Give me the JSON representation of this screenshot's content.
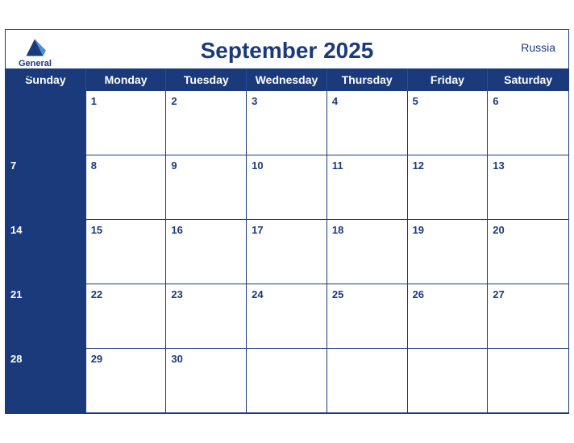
{
  "header": {
    "logo": {
      "general": "General",
      "blue": "Blue"
    },
    "title": "September 2025",
    "country": "Russia"
  },
  "days": [
    "Sunday",
    "Monday",
    "Tuesday",
    "Wednesday",
    "Thursday",
    "Friday",
    "Saturday"
  ],
  "weeks": [
    [
      {
        "date": "",
        "rowStart": true
      },
      {
        "date": "1",
        "rowStart": false
      },
      {
        "date": "2",
        "rowStart": false
      },
      {
        "date": "3",
        "rowStart": false
      },
      {
        "date": "4",
        "rowStart": false
      },
      {
        "date": "5",
        "rowStart": false
      },
      {
        "date": "6",
        "rowStart": false
      }
    ],
    [
      {
        "date": "7",
        "rowStart": true
      },
      {
        "date": "8",
        "rowStart": false
      },
      {
        "date": "9",
        "rowStart": false
      },
      {
        "date": "10",
        "rowStart": false
      },
      {
        "date": "11",
        "rowStart": false
      },
      {
        "date": "12",
        "rowStart": false
      },
      {
        "date": "13",
        "rowStart": false
      }
    ],
    [
      {
        "date": "14",
        "rowStart": true
      },
      {
        "date": "15",
        "rowStart": false
      },
      {
        "date": "16",
        "rowStart": false
      },
      {
        "date": "17",
        "rowStart": false
      },
      {
        "date": "18",
        "rowStart": false
      },
      {
        "date": "19",
        "rowStart": false
      },
      {
        "date": "20",
        "rowStart": false
      }
    ],
    [
      {
        "date": "21",
        "rowStart": true
      },
      {
        "date": "22",
        "rowStart": false
      },
      {
        "date": "23",
        "rowStart": false
      },
      {
        "date": "24",
        "rowStart": false
      },
      {
        "date": "25",
        "rowStart": false
      },
      {
        "date": "26",
        "rowStart": false
      },
      {
        "date": "27",
        "rowStart": false
      }
    ],
    [
      {
        "date": "28",
        "rowStart": true
      },
      {
        "date": "29",
        "rowStart": false
      },
      {
        "date": "30",
        "rowStart": false
      },
      {
        "date": "",
        "rowStart": false
      },
      {
        "date": "",
        "rowStart": false
      },
      {
        "date": "",
        "rowStart": false
      },
      {
        "date": "",
        "rowStart": false
      }
    ]
  ]
}
